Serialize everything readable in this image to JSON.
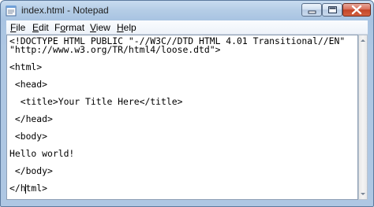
{
  "window": {
    "title": "index.html - Notepad",
    "icons": {
      "app": "notepad-icon",
      "minimize": "minimize-icon",
      "maximize": "maximize-icon",
      "close": "close-icon"
    }
  },
  "menu": {
    "items": [
      {
        "label": "File",
        "access_key": "F"
      },
      {
        "label": "Edit",
        "access_key": "E"
      },
      {
        "label": "Format",
        "access_key": "o"
      },
      {
        "label": "View",
        "access_key": "V"
      },
      {
        "label": "Help",
        "access_key": "H"
      }
    ]
  },
  "editor": {
    "lines": [
      "<!DOCTYPE HTML PUBLIC \"-//W3C//DTD HTML 4.01 Transitional//EN\"",
      "\"http://www.w3.org/TR/html4/loose.dtd\">",
      "",
      "<html>",
      "",
      " <head>",
      "",
      "  <title>Your Title Here</title>",
      "",
      " </head>",
      "",
      " <body>",
      "",
      "Hello world!",
      "",
      " </body>",
      "",
      "</html>"
    ]
  },
  "scrollbar": {
    "up_icon": "arrow-up-icon",
    "down_icon": "arrow-down-icon"
  }
}
